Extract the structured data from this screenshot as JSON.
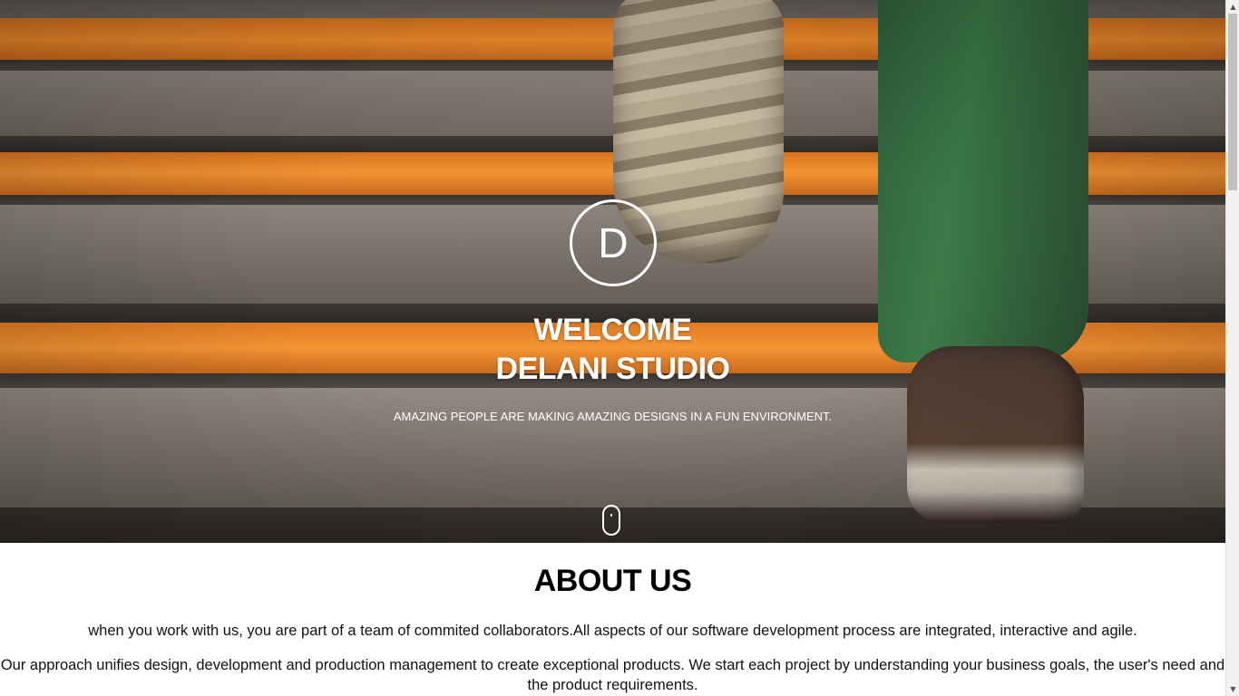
{
  "hero": {
    "logo_letter": "D",
    "title_line1": "WELCOME",
    "title_line2": "DELANI STUDIO",
    "subtitle": "AMAZING PEOPLE ARE MAKING AMAZING DESIGNS IN A FUN ENVIRONMENT.",
    "scroll_icon": "mouse-scroll-icon"
  },
  "about": {
    "heading": "ABOUT US",
    "paragraph1": "when you work with us, you are part of a team of commited collaborators.All aspects of our software development process are integrated, interactive and agile.",
    "paragraph2": "Our approach unifies design, development and production management to create exceptional products. We start each project by understanding your business goals, the user's need and the product requirements."
  },
  "scrollbar": {
    "up_arrow": "▲",
    "down_arrow": "▼"
  },
  "colors": {
    "hero_text": "#ffffff",
    "accent_orange": "#f08c2a",
    "body_text": "#111111"
  }
}
